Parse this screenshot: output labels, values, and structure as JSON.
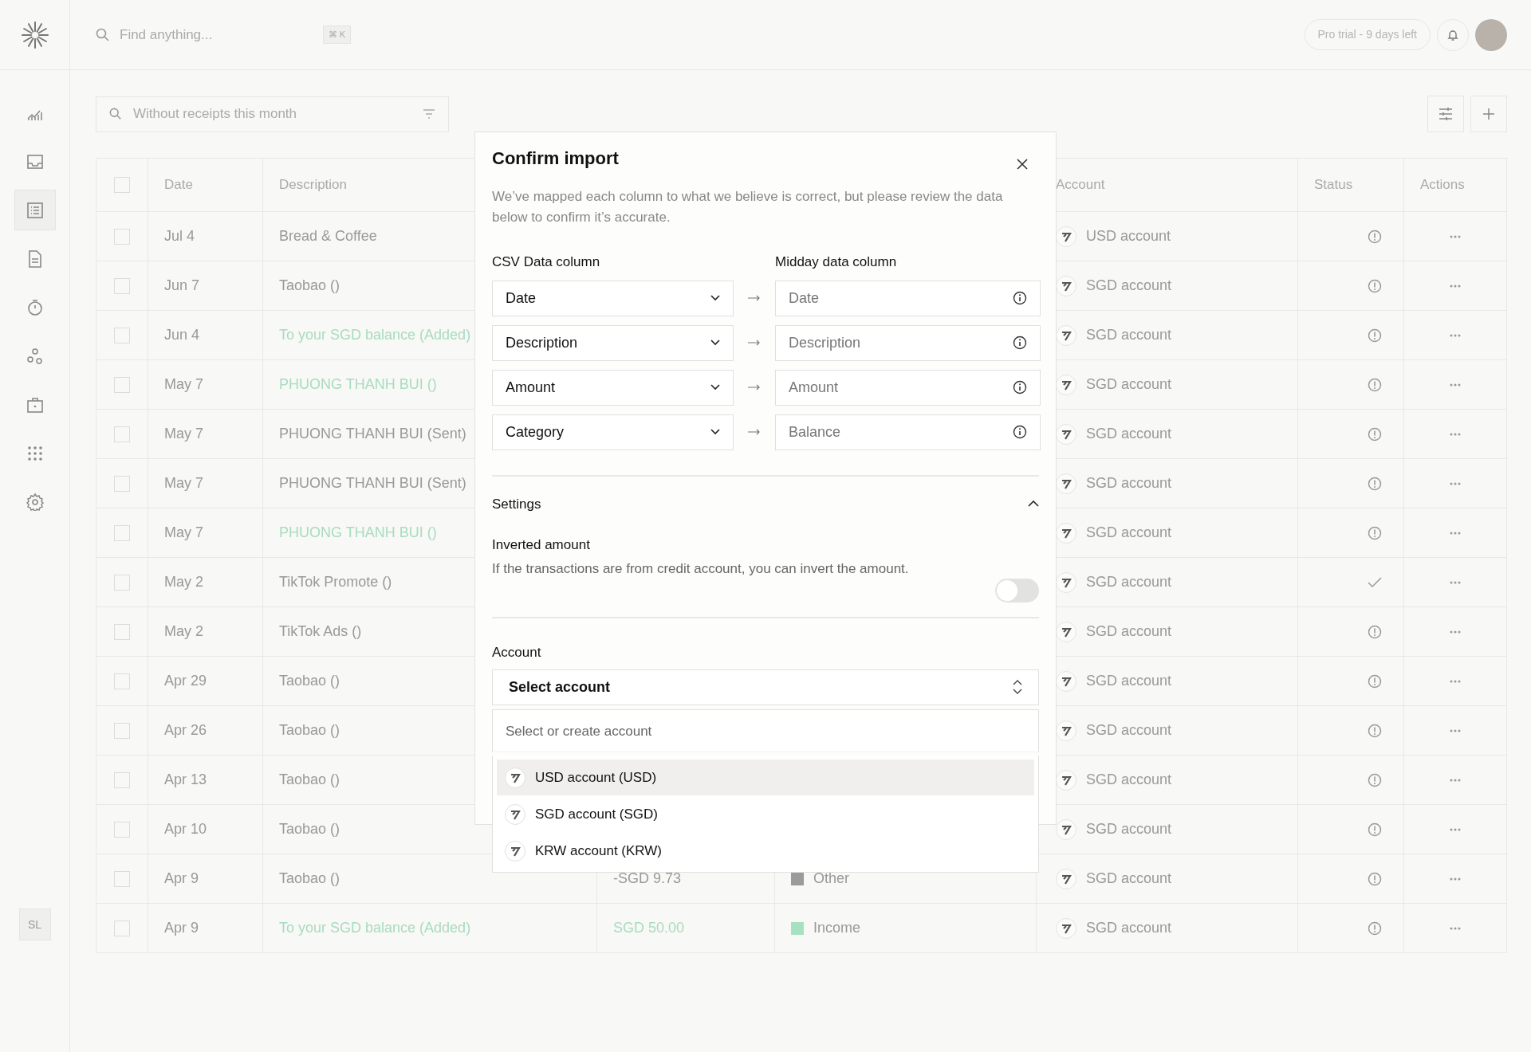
{
  "header": {
    "search": {
      "placeholder": "Find anything...",
      "shortcut": "⌘ K"
    },
    "trial_badge": "Pro trial - 9 days left"
  },
  "sidebar": {
    "items": [
      {
        "selected": false
      },
      {
        "selected": false
      },
      {
        "selected": true
      },
      {
        "selected": false
      },
      {
        "selected": false
      },
      {
        "selected": false
      },
      {
        "selected": false
      },
      {
        "selected": false
      },
      {
        "selected": false
      }
    ],
    "user_initials": "SL"
  },
  "toolbar": {
    "filter_search": {
      "placeholder": "Without receipts this month"
    }
  },
  "table": {
    "select_all_checked": false,
    "columns": {
      "date": "Date",
      "description": "Description",
      "account": "Account",
      "status": "Status",
      "actions": "Actions"
    },
    "rows": [
      {
        "checked": false,
        "date": "Jul 4",
        "description": "Bread & Coffee",
        "kind": "expense",
        "account": "USD account",
        "complete": false
      },
      {
        "checked": false,
        "date": "Jun 7",
        "description": "Taobao ()",
        "kind": "expense",
        "account": "SGD account",
        "complete": false
      },
      {
        "checked": false,
        "date": "Jun 4",
        "description": "To your SGD balance (Added)",
        "kind": "income",
        "account": "SGD account",
        "complete": false
      },
      {
        "checked": false,
        "date": "May 7",
        "description": "PHUONG THANH BUI ()",
        "kind": "income",
        "account": "SGD account",
        "complete": false
      },
      {
        "checked": false,
        "date": "May 7",
        "description": "PHUONG THANH BUI (Sent)",
        "kind": "expense",
        "account": "SGD account",
        "complete": false
      },
      {
        "checked": false,
        "date": "May 7",
        "description": "PHUONG THANH BUI (Sent)",
        "kind": "expense",
        "account": "SGD account",
        "complete": false
      },
      {
        "checked": false,
        "date": "May 7",
        "description": "PHUONG THANH BUI ()",
        "kind": "income",
        "account": "SGD account",
        "complete": false
      },
      {
        "checked": false,
        "date": "May 2",
        "description": "TikTok Promote ()",
        "kind": "expense",
        "account": "SGD account",
        "complete": true
      },
      {
        "checked": false,
        "date": "May 2",
        "description": "TikTok Ads ()",
        "kind": "expense",
        "account": "SGD account",
        "complete": false
      },
      {
        "checked": false,
        "date": "Apr 29",
        "description": "Taobao ()",
        "kind": "expense",
        "account": "SGD account",
        "complete": false
      },
      {
        "checked": false,
        "date": "Apr 26",
        "description": "Taobao ()",
        "kind": "expense",
        "account": "SGD account",
        "complete": false
      },
      {
        "checked": false,
        "date": "Apr 13",
        "description": "Taobao ()",
        "kind": "expense",
        "account": "SGD account",
        "complete": false
      },
      {
        "checked": false,
        "date": "Apr 10",
        "description": "Taobao ()",
        "kind": "expense",
        "account": "SGD account",
        "complete": false
      },
      {
        "checked": false,
        "date": "Apr 9",
        "description": "Taobao ()",
        "kind": "expense",
        "amount": "-SGD 9.73",
        "category": {
          "label": "Other",
          "color": "#9b9b9b"
        },
        "account": "SGD account",
        "complete": false
      },
      {
        "checked": false,
        "date": "Apr 9",
        "description": "To your SGD balance (Added)",
        "kind": "income",
        "amount": "SGD 50.00",
        "category": {
          "label": "Income",
          "color": "#a8e0c2"
        },
        "account": "SGD account",
        "complete": false
      }
    ]
  },
  "modal": {
    "title": "Confirm import",
    "description": "We’ve mapped each column to what we believe is correct, but please review the data below to confirm it’s accurate.",
    "csv_heading": "CSV Data column",
    "midday_heading": "Midday data column",
    "mappings": [
      {
        "csv": "Date",
        "midday": "Date"
      },
      {
        "csv": "Description",
        "midday": "Description"
      },
      {
        "csv": "Amount",
        "midday": "Amount"
      },
      {
        "csv": "Category",
        "midday": "Balance"
      }
    ],
    "settings": {
      "title": "Settings",
      "expanded": true,
      "inverted_amount": {
        "title": "Inverted amount",
        "description": "If the transactions are from credit account, you can invert the amount.",
        "on": false
      }
    },
    "account": {
      "label": "Account",
      "select": "Select account",
      "dropdown": {
        "placeholder": "Select or create account",
        "options": [
          {
            "label": "USD account (USD)",
            "selected": true
          },
          {
            "label": "SGD account (SGD)",
            "selected": false
          },
          {
            "label": "KRW account (KRW)",
            "selected": false
          }
        ]
      }
    }
  }
}
